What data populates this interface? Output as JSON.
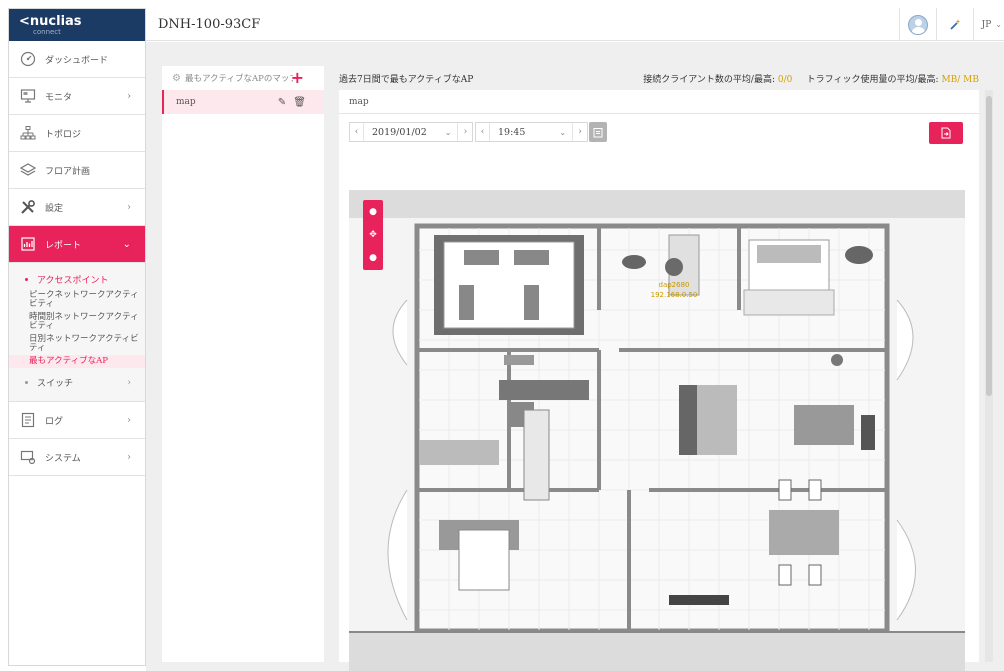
{
  "brand": {
    "name": "nuclias",
    "sub": "connect",
    "back": "<"
  },
  "header": {
    "title": "DNH-100-93CF",
    "lang": "JP"
  },
  "sidebar": {
    "items": [
      {
        "label": "ダッシュボード"
      },
      {
        "label": "モニタ"
      },
      {
        "label": "トポロジ"
      },
      {
        "label": "フロア計画"
      },
      {
        "label": "設定"
      },
      {
        "label": "レポート"
      }
    ],
    "submenu": {
      "ap_head": "アクセスポイント",
      "links": [
        "ピークネットワークアクティビティ",
        "時間別ネットワークアクティビティ",
        "日別ネットワークアクティビティ",
        "最もアクティブなAP"
      ],
      "switch": "スイッチ"
    },
    "items_after": [
      {
        "label": "ログ"
      },
      {
        "label": "システム"
      }
    ]
  },
  "map_list": {
    "title": "最もアクティブなAPのマップ",
    "maps": [
      {
        "name": "map"
      }
    ]
  },
  "report": {
    "title": "過去7日間で最もアクティブなAP",
    "clients_label": "接続クライアント数の平均/最高:",
    "clients_value": "0/0",
    "traffic_label": "トラフィック使用量の平均/最高:",
    "traffic_value": "MB/ MB",
    "map_name": "map",
    "date": "2019/01/02",
    "time": "19:45"
  },
  "ap": {
    "name": "dap2680",
    "ip": "192.168.0.50"
  },
  "colors": {
    "accent": "#e8225a",
    "navy": "#1b3a64",
    "stat": "#d4a100"
  },
  "icons": [
    "dashboard-icon",
    "monitor-icon",
    "topology-icon",
    "floor-plan-icon",
    "settings-icon",
    "report-icon",
    "log-icon",
    "system-icon",
    "user-icon",
    "wand-icon",
    "gear-icon",
    "plus-icon",
    "edit-icon",
    "trash-icon",
    "export-icon",
    "calendar-icon"
  ]
}
